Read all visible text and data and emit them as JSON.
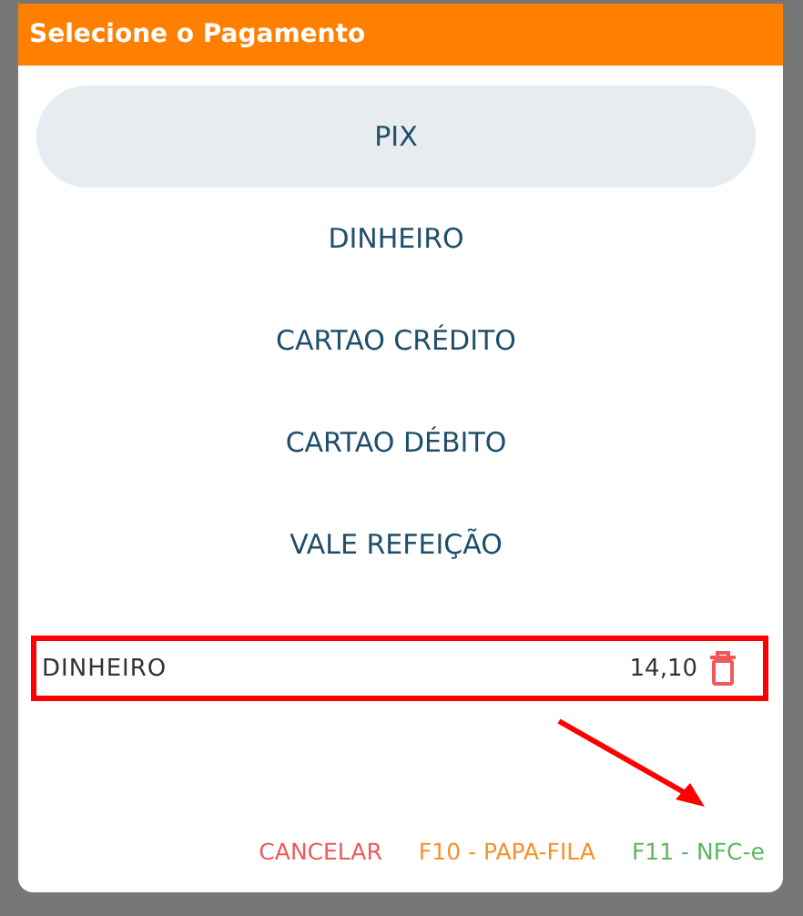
{
  "dialog": {
    "title": "Selecione o Pagamento"
  },
  "payment_options": [
    {
      "label": "PIX",
      "selected": true
    },
    {
      "label": "DINHEIRO",
      "selected": false
    },
    {
      "label": "CARTAO CRÉDITO",
      "selected": false
    },
    {
      "label": "CARTAO DÉBITO",
      "selected": false
    },
    {
      "label": "VALE REFEIÇÃO",
      "selected": false
    }
  ],
  "payments": [
    {
      "method": "DINHEIRO",
      "amount": "14,10"
    }
  ],
  "buttons": [
    {
      "label": "CANCELAR",
      "color": "#f0595b"
    },
    {
      "label": "F10 - PAPA-FILA",
      "color": "#f7922a"
    },
    {
      "label": "F11 - NFC-e",
      "color": "#5cb85c"
    }
  ]
}
